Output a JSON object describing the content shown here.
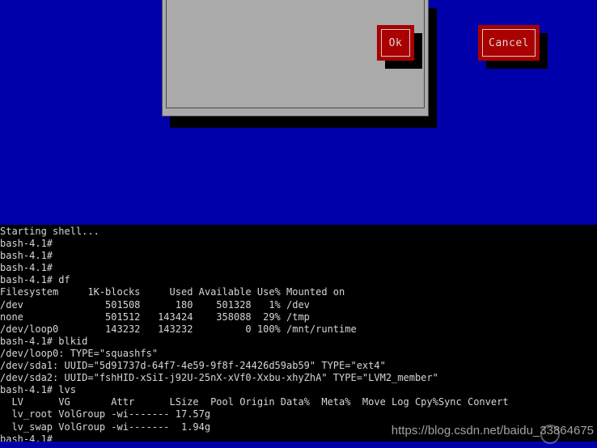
{
  "colors": {
    "installer_background": "#0000aa",
    "dialog_background": "#aaaaaa",
    "button_background": "#aa0000",
    "button_text": "#d8d8d8",
    "terminal_background": "#000000",
    "terminal_text": "#d6d6d6"
  },
  "dialog": {
    "body_text": "",
    "buttons": [
      {
        "label": "Ok",
        "name": "ok-button"
      },
      {
        "label": "Cancel",
        "name": "cancel-button"
      }
    ]
  },
  "terminal": {
    "prompt": "bash-4.1#",
    "lines": [
      "Starting shell...",
      "bash-4.1#",
      "bash-4.1#",
      "bash-4.1#",
      "bash-4.1# df",
      "Filesystem     1K-blocks     Used Available Use% Mounted on",
      "/dev              501508      180    501328   1% /dev",
      "none              501512   143424    358088  29% /tmp",
      "/dev/loop0        143232   143232         0 100% /mnt/runtime",
      "bash-4.1# blkid",
      "/dev/loop0: TYPE=\"squashfs\"",
      "/dev/sda1: UUID=\"5d91737d-64f7-4e59-9f8f-24426d59ab59\" TYPE=\"ext4\"",
      "/dev/sda2: UUID=\"fshHID-xSiI-j92U-25nX-xVf0-Xxbu-xhyZhA\" TYPE=\"LVM2_member\"",
      "bash-4.1# lvs",
      "  LV      VG       Attr      LSize  Pool Origin Data%  Meta%  Move Log Cpy%Sync Convert",
      "  lv_root VolGroup -wi------- 17.57g",
      "  lv_swap VolGroup -wi-------  1.94g"
    ],
    "last_prompt": "bash-4.1# ",
    "commands": [
      "df",
      "blkid",
      "lvs"
    ],
    "df_table": {
      "headers": [
        "Filesystem",
        "1K-blocks",
        "Used",
        "Available",
        "Use%",
        "Mounted on"
      ],
      "rows": [
        [
          "/dev",
          "501508",
          "180",
          "501328",
          "1%",
          "/dev"
        ],
        [
          "none",
          "501512",
          "143424",
          "358088",
          "29%",
          "/tmp"
        ],
        [
          "/dev/loop0",
          "143232",
          "143232",
          "0",
          "100%",
          "/mnt/runtime"
        ]
      ]
    },
    "blkid_entries": [
      {
        "device": "/dev/loop0",
        "uuid": "",
        "type": "squashfs"
      },
      {
        "device": "/dev/sda1",
        "uuid": "5d91737d-64f7-4e59-9f8f-24426d59ab59",
        "type": "ext4"
      },
      {
        "device": "/dev/sda2",
        "uuid": "fshHID-xSiI-j92U-25nX-xVf0-Xxbu-xhyZhA",
        "type": "LVM2_member"
      }
    ],
    "lvs_table": {
      "headers": [
        "LV",
        "VG",
        "Attr",
        "LSize",
        "Pool",
        "Origin",
        "Data%",
        "Meta%",
        "Move",
        "Log",
        "Cpy%Sync",
        "Convert"
      ],
      "rows": [
        [
          "lv_root",
          "VolGroup",
          "-wi-------",
          "17.57g",
          "",
          "",
          "",
          "",
          "",
          "",
          "",
          ""
        ],
        [
          "lv_swap",
          "VolGroup",
          "-wi-------",
          "1.94g",
          "",
          "",
          "",
          "",
          "",
          "",
          "",
          ""
        ]
      ]
    }
  },
  "watermark": {
    "text": "https://blog.csdn.net/baidu_33864675"
  }
}
